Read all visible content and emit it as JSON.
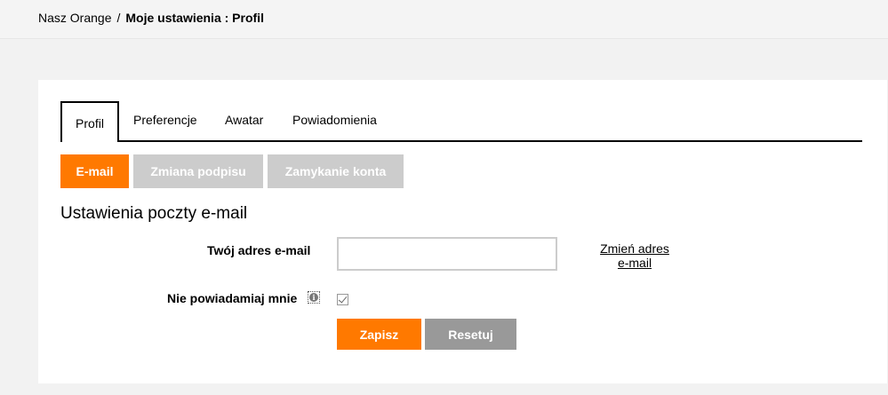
{
  "breadcrumb": {
    "home": "Nasz Orange",
    "separator": "/",
    "current": "Moje ustawienia : Profil"
  },
  "tabs": [
    {
      "label": "Profil",
      "active": true
    },
    {
      "label": "Preferencje",
      "active": false
    },
    {
      "label": "Awatar",
      "active": false
    },
    {
      "label": "Powiadomienia",
      "active": false
    }
  ],
  "subtabs": [
    {
      "label": "E-mail",
      "active": true
    },
    {
      "label": "Zmiana podpisu",
      "active": false
    },
    {
      "label": "Zamykanie konta",
      "active": false
    }
  ],
  "section": {
    "title": "Ustawienia poczty e-mail"
  },
  "form": {
    "email_label": "Twój adres e-mail",
    "email_value": "",
    "change_email_link": "Zmień adres e-mail",
    "notify_label": "Nie powiadamiaj mnie",
    "notify_checked": true,
    "info_icon": "info-icon",
    "save_label": "Zapisz",
    "reset_label": "Resetuj"
  },
  "colors": {
    "accent": "#ff7900",
    "inactive_tab": "#cccccc",
    "reset_button": "#999999",
    "page_background": "#f2f2f2"
  }
}
